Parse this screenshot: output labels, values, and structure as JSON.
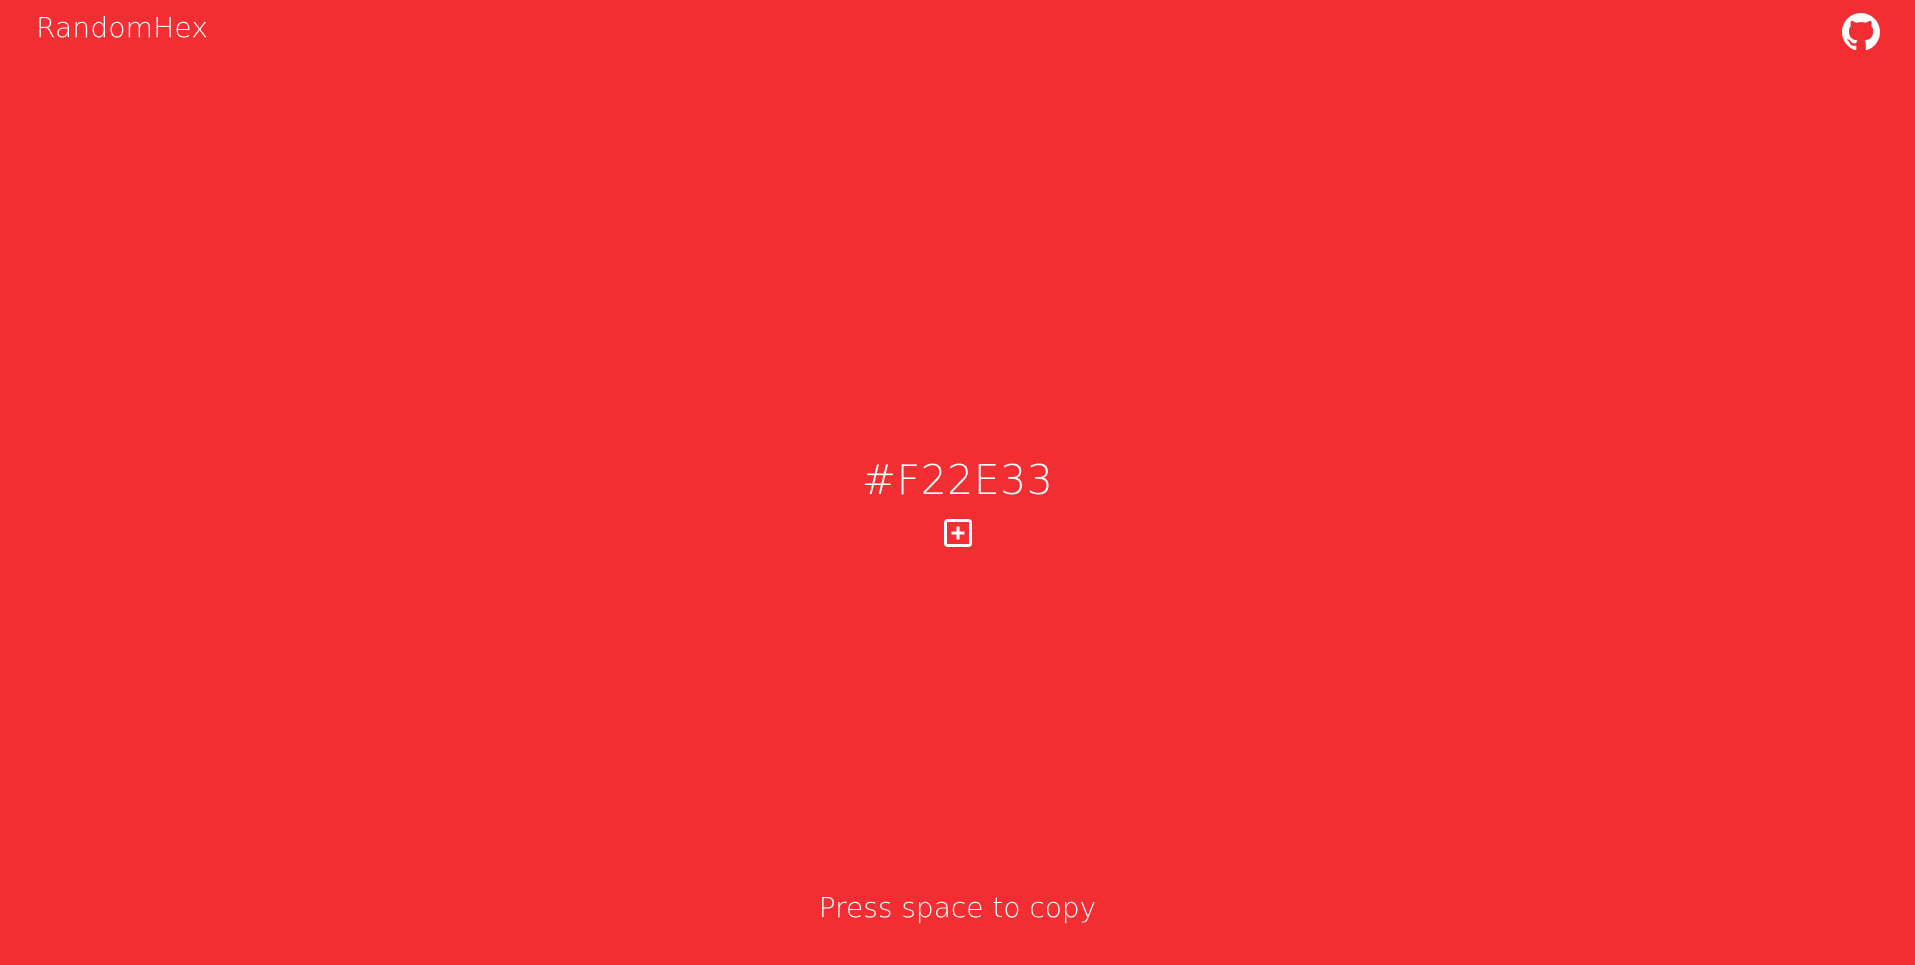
{
  "header": {
    "brand": "RandomHex",
    "github_icon": "github-icon"
  },
  "main": {
    "hex_value": "#F22E33",
    "add_icon": "plus-square-icon"
  },
  "footer": {
    "hint": "Press space to copy"
  },
  "colors": {
    "background": "#F22E33",
    "foreground": "#FFFFFF"
  }
}
